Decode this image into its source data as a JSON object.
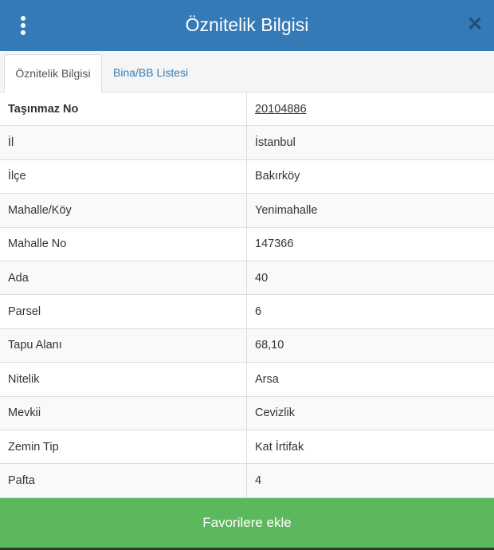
{
  "header": {
    "title": "Öznitelik Bilgisi",
    "menu_icon": "kebab-menu-icon",
    "close_icon": "close-icon",
    "close_glyph": "✕"
  },
  "tabs": [
    {
      "label": "Öznitelik Bilgisi",
      "active": true
    },
    {
      "label": "Bina/BB Listesi",
      "active": false
    }
  ],
  "attributes": [
    {
      "label": "Taşınmaz No",
      "value": "20104886"
    },
    {
      "label": "İl",
      "value": "İstanbul"
    },
    {
      "label": "İlçe",
      "value": "Bakırköy"
    },
    {
      "label": "Mahalle/Köy",
      "value": "Yenimahalle"
    },
    {
      "label": "Mahalle No",
      "value": "147366"
    },
    {
      "label": "Ada",
      "value": "40"
    },
    {
      "label": "Parsel",
      "value": "6"
    },
    {
      "label": "Tapu Alanı",
      "value": "68,10"
    },
    {
      "label": "Nitelik",
      "value": "Arsa"
    },
    {
      "label": "Mevkii",
      "value": "Cevizlik"
    },
    {
      "label": "Zemin Tip",
      "value": "Kat İrtifak"
    },
    {
      "label": "Pafta",
      "value": "4"
    }
  ],
  "footer": {
    "button_label": "Favorilere ekle"
  },
  "colors": {
    "header": "#337ab7",
    "button": "#5cb85c",
    "link": "#337ab7"
  }
}
